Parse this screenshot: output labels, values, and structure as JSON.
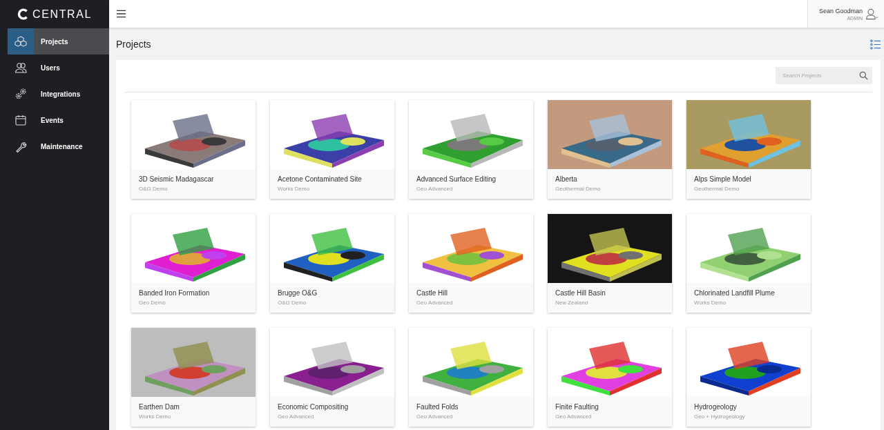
{
  "brand": {
    "name": "CENTRAL"
  },
  "sidebar": {
    "items": [
      {
        "label": "Projects",
        "selected": true
      },
      {
        "label": "Users",
        "selected": false
      },
      {
        "label": "Integrations",
        "selected": false
      },
      {
        "label": "Events",
        "selected": false
      },
      {
        "label": "Maintenance",
        "selected": false
      }
    ]
  },
  "user": {
    "name": "Sean Goodman",
    "role": "ADMIN"
  },
  "page": {
    "title": "Projects"
  },
  "search": {
    "placeholder": "Search Projects"
  },
  "projects": [
    {
      "name": "3D Seismic Madagascar",
      "category": "O&G Demo",
      "kind": "picture"
    },
    {
      "name": "Acetone Contaminated Site",
      "category": "Works Demo",
      "kind": "picture"
    },
    {
      "name": "Advanced Surface Editing",
      "category": "Geo Advanced",
      "kind": "picture"
    },
    {
      "name": "Alberta",
      "category": "Geothermal Demo",
      "kind": "picture"
    },
    {
      "name": "Alps Simple Model",
      "category": "Geothermal Demo",
      "kind": "picture"
    },
    {
      "name": "Banded Iron Formation",
      "category": "Geo Demo",
      "kind": "picture"
    },
    {
      "name": "Brugge O&G",
      "category": "O&G Demo",
      "kind": "picture"
    },
    {
      "name": "Castle Hill",
      "category": "Geo Advanced",
      "kind": "picture"
    },
    {
      "name": "Castle Hill Basin",
      "category": "New Zealand",
      "kind": "picture"
    },
    {
      "name": "Chlorinated Landfill Plume",
      "category": "Works Demo",
      "kind": "picture"
    },
    {
      "name": "Earthen Dam",
      "category": "Works Demo",
      "kind": "picture"
    },
    {
      "name": "Economic Compositing",
      "category": "Geo Advanced",
      "kind": "picture"
    },
    {
      "name": "Faulted Folds",
      "category": "Geo Advanced",
      "kind": "picture"
    },
    {
      "name": "Finite Faulting",
      "category": "Geo Advanced",
      "kind": "picture"
    },
    {
      "name": "Hydrogeology",
      "category": "Geo + Hydrogeology",
      "kind": "picture"
    }
  ]
}
